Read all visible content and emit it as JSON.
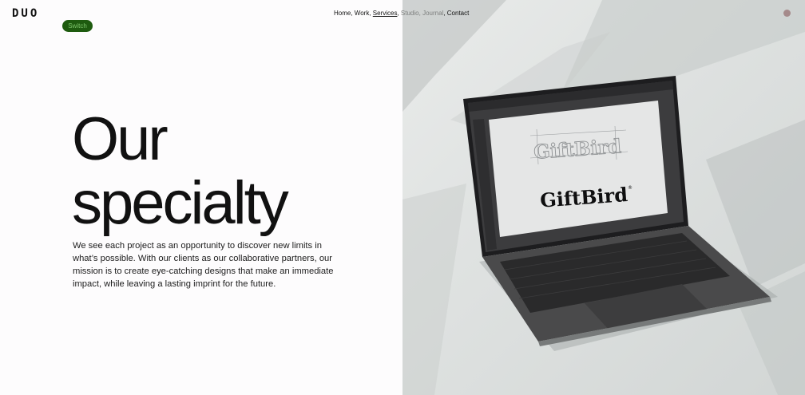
{
  "header": {
    "logo": "DUO",
    "switch_label": "Switch",
    "nav": [
      {
        "label": "Home",
        "active": false
      },
      {
        "label": "Work",
        "active": false
      },
      {
        "label": "Services",
        "active": true
      },
      {
        "label": "Studio",
        "active": false
      },
      {
        "label": "Journal",
        "active": false
      },
      {
        "label": "Contact",
        "active": false
      }
    ]
  },
  "hero": {
    "headline_line1": "Our",
    "headline_line2": "specialty",
    "description": "We see each project as an opportunity to discover new limits in what’s possible. With our clients as our collaborative partners, our mission is to create eye-catching designs that make an immediate impact, while leaving a lasting imprint for the future."
  },
  "photo": {
    "screen_logo_sketch": "GiftBird",
    "screen_logo": "GiftBird",
    "registered_mark": "®"
  },
  "colors": {
    "switch_bg": "#1e5b0f",
    "switch_text": "#7cc36a",
    "text": "#111111",
    "background": "#fdfcfd"
  }
}
